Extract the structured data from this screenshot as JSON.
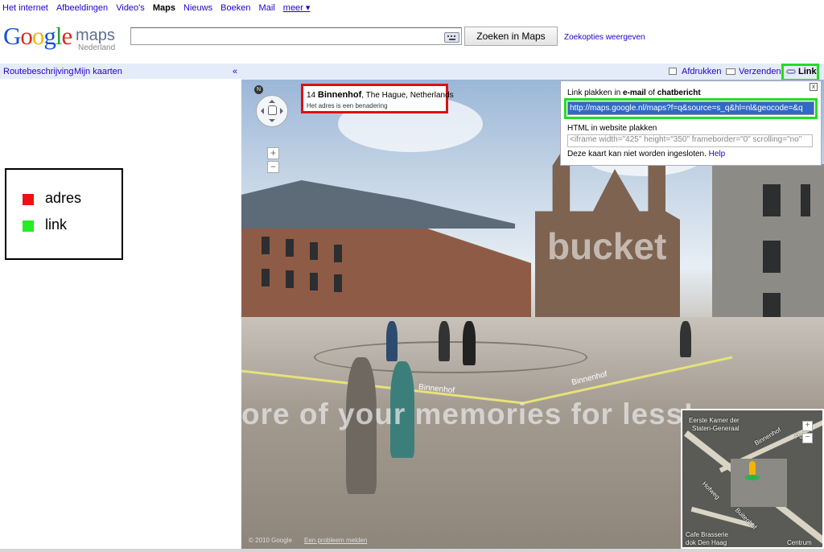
{
  "topnav": {
    "items": [
      "Het internet",
      "Afbeeldingen",
      "Video's",
      "Maps",
      "Nieuws",
      "Boeken",
      "Mail",
      "meer ▾"
    ],
    "active": "Maps"
  },
  "header": {
    "logo_word": "Google",
    "logo_product": "maps",
    "logo_region": "Nederland",
    "search_value": "",
    "search_button": "Zoeken in Maps",
    "search_options": "Zoekopties weergeven"
  },
  "sidebar": {
    "route": "Routebeschrijving",
    "my_maps": "Mijn kaarten",
    "collapse": "«"
  },
  "toolbar": {
    "print": "Afdrukken",
    "send": "Verzenden",
    "link": "Link"
  },
  "legend": {
    "items": [
      {
        "label": "adres",
        "color": "#ee1111"
      },
      {
        "label": "link",
        "color": "#22ee22"
      }
    ]
  },
  "address": {
    "number": "14 ",
    "street": "Binnenhof",
    "city": ", The Hague, Netherlands",
    "note": "Het adres is een benadering"
  },
  "link_popup": {
    "email_prefix": "Link plakken in ",
    "email_bold1": "e-mail",
    "email_mid": " of ",
    "email_bold2": "chatbericht",
    "link_url": "http://maps.google.nl/maps?f=q&source=s_q&hl=nl&geocode=&q",
    "embed_label": "HTML in website plakken",
    "embed_code": "<iframe width=\"425\" height=\"350\" frameborder=\"0\" scrolling=\"no\"",
    "not_embeddable": "Deze kaart kan niet worden ingesloten.",
    "help": "Help",
    "close": "x"
  },
  "streetview": {
    "watermark": "ore of your memories for less!",
    "watermark2": "bucket",
    "road_label_1": "Binnenhof",
    "road_label_2": "Binnenhof",
    "compass": "N",
    "zoom_in": "+",
    "zoom_out": "−",
    "copyright": "© 2010 Google",
    "report": "Een probleem melden"
  },
  "minimap": {
    "labels": [
      "Eerste Kamer der",
      "Staten-Generaal",
      "Binnenhof",
      "Hofweg",
      "Buitenhof",
      "Cafe Brasserie",
      "dok Den Haag",
      "Centrum",
      "Pd"
    ],
    "zoom_in": "+",
    "zoom_out": "−"
  },
  "colors": {
    "accent_blue": "#2200cc",
    "highlight_red": "#dd1111",
    "highlight_green": "#22dd22",
    "bar_bg": "#e5ecf9"
  }
}
